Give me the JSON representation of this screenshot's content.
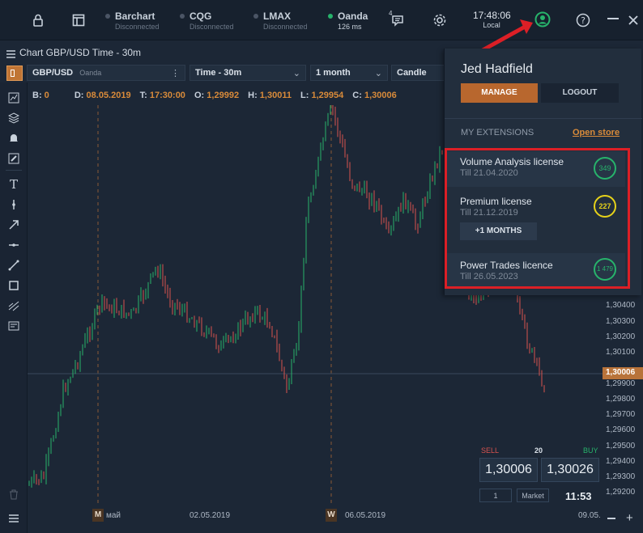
{
  "connections": [
    {
      "name": "Barchart",
      "status": "Disconnected",
      "online": false
    },
    {
      "name": "CQG",
      "status": "Disconnected",
      "online": false
    },
    {
      "name": "LMAX",
      "status": "Disconnected",
      "online": false
    },
    {
      "name": "Oanda",
      "status": "126 ms",
      "online": true
    }
  ],
  "topbar": {
    "notification_count": "4",
    "time": "17:48:06",
    "time_label": "Local"
  },
  "chart": {
    "title": "Chart GBP/USD Time - 30m",
    "symbol": "GBP/USD",
    "symbol_source": "Oanda",
    "timeframe": "Time - 30m",
    "range": "1 month",
    "style": "Candle",
    "ohlc": {
      "b_label": "B:",
      "b_value": "0",
      "d_label": "D:",
      "d_value": "08.05.2019",
      "t_label": "T:",
      "t_value": "17:30:00",
      "o_label": "O:",
      "o_value": "1,29992",
      "h_label": "H:",
      "h_value": "1,30011",
      "l_label": "L:",
      "l_value": "1,29954",
      "c_label": "C:",
      "c_value": "1,30006"
    },
    "price_labels": [
      "1,30400",
      "1,30300",
      "1,30200",
      "1,30100",
      "1,30006",
      "1,29900",
      "1,29800",
      "1,29700",
      "1,29600",
      "1,29500",
      "1,29400",
      "1,29300",
      "1,29200"
    ],
    "current_price": "1,30006",
    "time_labels": {
      "m_box": "M",
      "may": "май",
      "d1": "02.05.2019",
      "w_box": "W",
      "d2": "06.05.2019",
      "d3": "09.05."
    },
    "colors": {
      "up": "#27b36b",
      "down": "#d9534f",
      "accent": "#d98b3a"
    }
  },
  "trade": {
    "sell_label": "SELL",
    "buy_label": "BUY",
    "spread": "20",
    "sell_price": "1,30006",
    "buy_price": "1,30026",
    "quantity": "1",
    "order_type": "Market",
    "time": "11:53"
  },
  "account": {
    "user_name": "Jed Hadfield",
    "manage_label": "MANAGE",
    "logout_label": "LOGOUT",
    "extensions_label": "MY EXTENSIONS",
    "open_store_label": "Open store",
    "licenses": [
      {
        "name": "Volume Analysis license",
        "till": "Till 21.04.2020",
        "days": "349",
        "color": "#27b36b"
      },
      {
        "name": "Premium license",
        "till": "Till 21.12.2019",
        "days": "227",
        "color": "#e6d21a",
        "action": "+1 MONTHS"
      },
      {
        "name": "Power Trades licence",
        "till": "Till 26.05.2023",
        "days": "1 479",
        "color": "#27b36b"
      }
    ]
  }
}
